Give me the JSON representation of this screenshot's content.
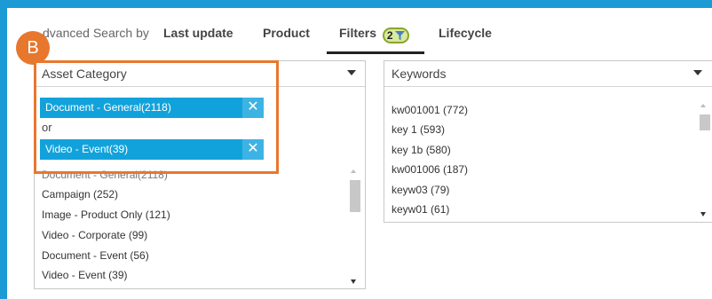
{
  "tabs": {
    "prefix": "dvanced Search by",
    "items": [
      {
        "label": "Last update"
      },
      {
        "label": "Product"
      },
      {
        "label": "Filters",
        "count": "2"
      },
      {
        "label": "Lifecycle"
      }
    ],
    "active": "Filters"
  },
  "badge": {
    "label": "B"
  },
  "asset_category": {
    "label": "Asset Category",
    "selected": [
      {
        "label": "Document - General(2118)"
      },
      {
        "label": "Video - Event(39)"
      }
    ],
    "or_text": "or",
    "options": [
      "Document - General(2118)",
      "Campaign (252)",
      "Image - Product Only (121)",
      "Video - Corporate (99)",
      "Document - Event (56)",
      "Video - Event (39)"
    ]
  },
  "keywords": {
    "label": "Keywords",
    "options": [
      "kw001001 (772)",
      "key 1 (593)",
      "key 1b (580)",
      "kw001006 (187)",
      "keyw03 (79)",
      "keyw01 (61)"
    ]
  },
  "colors": {
    "accent_blue": "#1b9ad6",
    "chip_blue": "#12a2db",
    "highlight_orange": "#e8772e"
  },
  "icons": [
    "funnel-icon",
    "close-icon",
    "caret-down-icon"
  ]
}
